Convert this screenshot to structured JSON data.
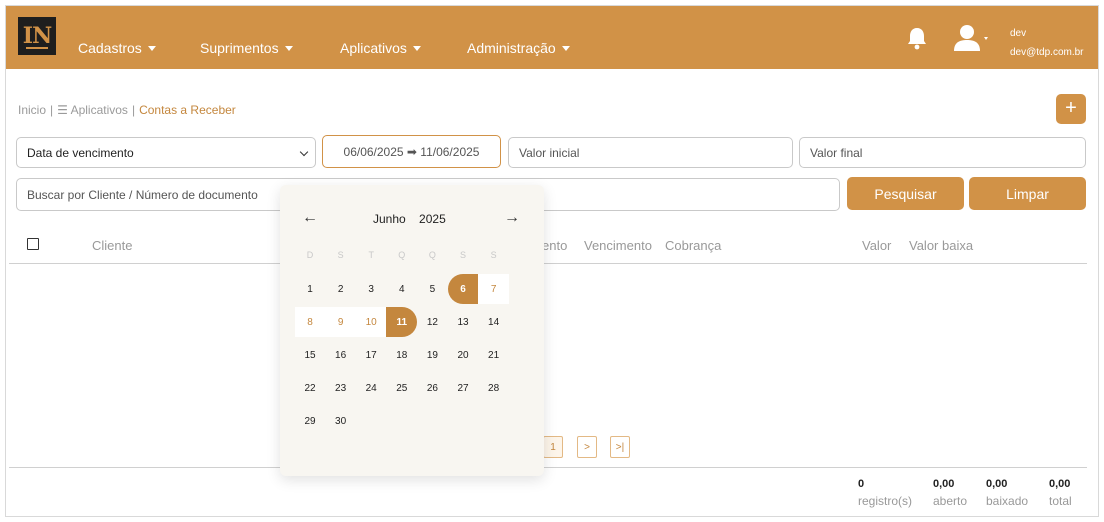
{
  "colors": {
    "accent": "#d19247",
    "accent_text": "#c4873e",
    "logo_bg": "#1e1e1e"
  },
  "header": {
    "logo_text": "IN",
    "menu": [
      "Cadastros",
      "Suprimentos",
      "Aplicativos",
      "Administração"
    ],
    "user_name": "dev",
    "user_email": "dev@tdp.com.br",
    "icons": [
      "bell-icon",
      "user-icon"
    ]
  },
  "breadcrumb": {
    "home": "Inicio",
    "sep": "|",
    "apps": "☰ Aplicativos",
    "current": "Contas a Receber"
  },
  "add_button_label": "+",
  "filters": {
    "date_type": "Data de vencimento",
    "date_range": "06/06/2025 ➡ 11/06/2025",
    "valor_inicial_placeholder": "Valor inicial",
    "valor_final_placeholder": "Valor final",
    "search_placeholder": "Buscar por Cliente / Número de documento",
    "search_button": "Pesquisar",
    "clear_button": "Limpar"
  },
  "table": {
    "headers": [
      "Cliente",
      "ento",
      "Vencimento",
      "Cobrança",
      "Valor",
      "Valor baixa"
    ]
  },
  "pagination": {
    "current": "1",
    "next": ">",
    "last": ">|"
  },
  "summary": [
    {
      "value": "0",
      "label": "registro(s)"
    },
    {
      "value": "0,00",
      "label": "aberto"
    },
    {
      "value": "0,00",
      "label": "baixado"
    },
    {
      "value": "0,00",
      "label": "total"
    }
  ],
  "calendar": {
    "month": "Junho",
    "year": "2025",
    "prev": "←",
    "next": "→",
    "weekdays": [
      "D",
      "S",
      "T",
      "Q",
      "Q",
      "S",
      "S"
    ],
    "first_weekday": 0,
    "days_in_month": 30,
    "range_start": 6,
    "range_end": 11
  }
}
